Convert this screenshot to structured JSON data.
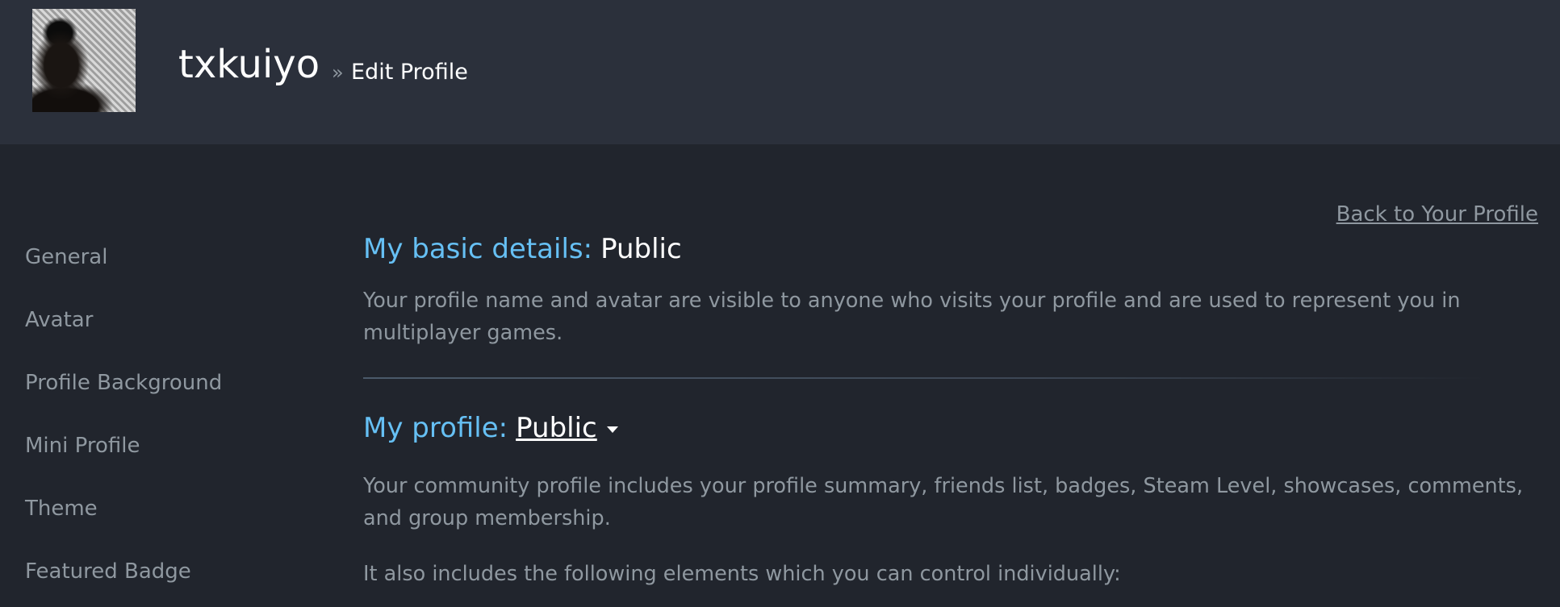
{
  "header": {
    "avatar_alt": "User avatar",
    "username": "txkuiyo",
    "separator": "»",
    "page": "Edit Profile"
  },
  "sidebar": {
    "items": [
      {
        "label": "General"
      },
      {
        "label": "Avatar"
      },
      {
        "label": "Profile Background"
      },
      {
        "label": "Mini Profile"
      },
      {
        "label": "Theme"
      },
      {
        "label": "Featured Badge"
      }
    ]
  },
  "main": {
    "back_link": "Back to Your Profile",
    "basic_details": {
      "title": "My basic details:",
      "value": "Public",
      "description": "Your profile name and avatar are visible to anyone who visits your profile and are used to represent you in multiplayer games."
    },
    "profile": {
      "title": "My profile:",
      "value": "Public",
      "description": "Your community profile includes your profile summary, friends list, badges, Steam Level, showcases, comments, and group membership.",
      "note": "It also includes the following elements which you can control individually:"
    }
  },
  "colors": {
    "page_bg": "#21252d",
    "header_bg": "#2b303b",
    "accent": "#66c0f4",
    "muted_text": "#8f98a0",
    "text": "#ffffff"
  }
}
